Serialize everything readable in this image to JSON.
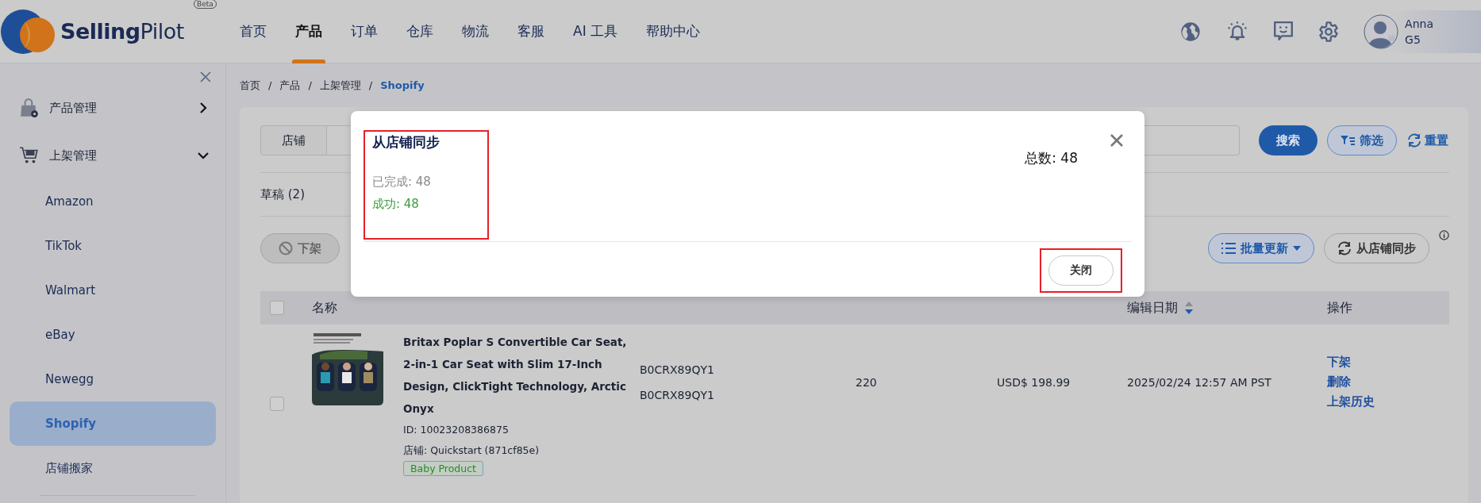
{
  "logo": {
    "name": "**Selling**Pilot",
    "badge": "Beta"
  },
  "nav": [
    {
      "label": "首页",
      "selected": false
    },
    {
      "label": "产品",
      "selected": true
    },
    {
      "label": "订单",
      "selected": false
    },
    {
      "label": "仓库",
      "selected": false
    },
    {
      "label": "物流",
      "selected": false
    },
    {
      "label": "客服",
      "selected": false
    },
    {
      "label": "AI 工具",
      "selected": false
    },
    {
      "label": "帮助中心",
      "selected": false
    }
  ],
  "user": {
    "name": "Anna",
    "tier": "G5"
  },
  "sidebar": {
    "items": [
      {
        "label": "产品管理",
        "expanded": false
      },
      {
        "label": "上架管理",
        "expanded": true,
        "children": [
          {
            "label": "Amazon",
            "selected": false
          },
          {
            "label": "TikTok",
            "selected": false
          },
          {
            "label": "Walmart",
            "selected": false
          },
          {
            "label": "eBay",
            "selected": false
          },
          {
            "label": "Newegg",
            "selected": false
          },
          {
            "label": "Shopify",
            "selected": true
          },
          {
            "label": "店铺搬家",
            "selected": false
          }
        ]
      }
    ]
  },
  "breadcrumb": [
    {
      "label": "首页",
      "current": false
    },
    {
      "separator": "/",
      "label": "产品",
      "current": false
    },
    {
      "separator": "/",
      "label": "上架管理",
      "current": false
    },
    {
      "separator": "/",
      "label": "Shopify",
      "current": true
    }
  ],
  "filter": {
    "field_label": "店铺",
    "search": "搜索",
    "filter": "筛选",
    "reset": "重置"
  },
  "draft_tab": "草稿 (2)",
  "toolbar": {
    "delist": {
      "label": "下架",
      "disabled": true
    },
    "bulk_update": "批量更新",
    "sync": "从店铺同步"
  },
  "table": {
    "all_checked": false,
    "columns": [
      {
        "label": "名称"
      },
      {
        "label": "编辑日期",
        "sort_desc": true
      },
      {
        "label": "操作"
      }
    ],
    "rows": [
      {
        "checked": false,
        "title": "Britax Poplar S Convertible Car Seat, 2-in-1 Car Seat with Slim 17-Inch Design, ClickTight Technology, Arctic Onyx",
        "id": "ID: 10023208386875",
        "store": "店铺: Quickstart (871cf85e)",
        "tag": "Baby Product",
        "sku": "B0CRX89QY1",
        "store_sku": "B0CRX89QY1",
        "stock": "220",
        "price": "USD$ 198.99",
        "edited": "2025/02/24 12:57 AM PST",
        "actions": [
          "下架",
          "删除",
          "上架历史"
        ]
      }
    ]
  },
  "modal": {
    "title": "从店铺同步",
    "completed": "已完成: 48",
    "success": "成功: 48",
    "total": "总数: 48",
    "close_button": "关闭"
  }
}
